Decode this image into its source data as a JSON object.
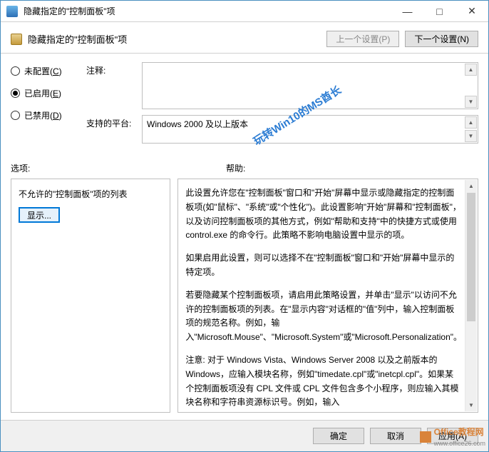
{
  "window": {
    "title": "隐藏指定的\"控制面板\"项"
  },
  "header": {
    "title": "隐藏指定的\"控制面板\"项",
    "prev_btn": "上一个设置(P)",
    "next_btn": "下一个设置(N)"
  },
  "radios": {
    "not_configured": "未配置(C)",
    "enabled": "已启用(E)",
    "disabled": "已禁用(D)"
  },
  "form": {
    "comment_label": "注释:",
    "platform_label": "支持的平台:",
    "platform_value": "Windows 2000 及以上版本"
  },
  "options": {
    "label": "选项:",
    "help_label": "帮助:"
  },
  "left_panel": {
    "list_label": "不允许的\"控制面板\"项的列表",
    "show_btn": "显示..."
  },
  "help": {
    "p1": "此设置允许您在\"控制面板\"窗口和\"开始\"屏幕中显示或隐藏指定的控制面板项(如\"鼠标\"、\"系统\"或\"个性化\")。此设置影响\"开始\"屏幕和\"控制面板\"，以及访问控制面板项的其他方式，例如\"帮助和支持\"中的快捷方式或使用 control.exe 的命令行。此策略不影响电脑设置中显示的项。",
    "p2": "如果启用此设置，则可以选择不在\"控制面板\"窗口和\"开始\"屏幕中显示的特定项。",
    "p3": "若要隐藏某个控制面板项，请启用此策略设置，并单击\"显示\"以访问不允许的控制面板项的列表。在\"显示内容\"对话框的\"值\"列中，输入控制面板项的规范名称。例如，输入\"Microsoft.Mouse\"、\"Microsoft.System\"或\"Microsoft.Personalization\"。",
    "p4": "注意: 对于 Windows Vista、Windows Server 2008 以及之前版本的 Windows，应输入模块名称，例如\"timedate.cpl\"或\"inetcpl.cpl\"。如果某个控制面板项没有 CPL 文件或 CPL 文件包含多个小程序，则应输入其模块名称和字符串资源标识号。例如，输入"
  },
  "footer": {
    "ok": "确定",
    "cancel": "取消",
    "apply": "应用(A)"
  },
  "watermarks": {
    "diagonal": "玩转Win10的MS酋长",
    "corner": "Office教程网",
    "corner_url": "www.office26.com"
  }
}
